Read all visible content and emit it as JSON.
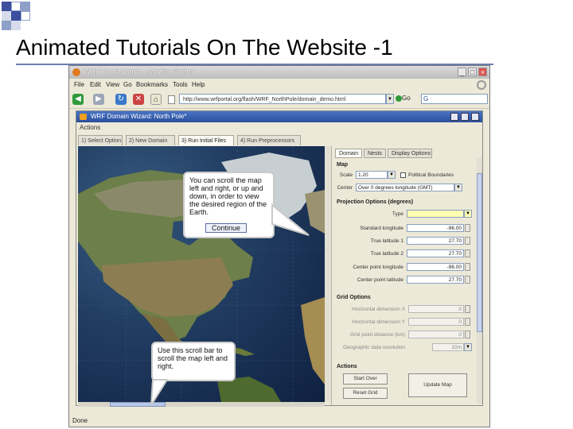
{
  "slide": {
    "title": "Animated Tutorials On The Website -1",
    "accent_color": "#3b4f9e"
  },
  "browser": {
    "window_title": "WRF Portal Demo - Mozilla Firefox",
    "menu": [
      "File",
      "Edit",
      "View",
      "Go",
      "Bookmarks",
      "Tools",
      "Help"
    ],
    "url": "http://www.wrfportal.org/flash/WRF_NorthPole/domain_demo.html",
    "go_label": "Go",
    "status_text": "Done"
  },
  "app": {
    "window_title": "WRF Domain Wizard: North Pole*",
    "menu_label": "Actions",
    "tabs": [
      "1) Select Option",
      "2) New Domain",
      "3) Run Initial Files",
      "4) Run Preprocessors"
    ],
    "panel_tabs": [
      "Domain",
      "Nests",
      "Display Options"
    ],
    "map_section": {
      "title": "Map",
      "scale_label": "Scale",
      "scale_value": "1.20",
      "political_boundaries_label": "Political Boundaries",
      "center_label": "Center",
      "center_value": "Over 0 degrees longitude (GMT)"
    },
    "projection_section": {
      "title": "Projection Options (degrees)",
      "fields": [
        {
          "label": "Type",
          "value": ""
        },
        {
          "label": "Standard longitude",
          "value": "-96.00"
        },
        {
          "label": "True latitude 1",
          "value": "27.70"
        },
        {
          "label": "True latitude 2",
          "value": "27.70"
        },
        {
          "label": "Center point longitude",
          "value": "-96.00"
        },
        {
          "label": "Center point latitude",
          "value": "27.70"
        }
      ]
    },
    "grid_section": {
      "title": "Grid Options",
      "fields": [
        {
          "label": "Horizontal dimension X",
          "value": "0"
        },
        {
          "label": "Horizontal dimension Y",
          "value": "0"
        },
        {
          "label": "Grid point distance (km)",
          "value": "0"
        },
        {
          "label": "Geographic data resolution",
          "value": "10m"
        }
      ]
    },
    "actions_section": {
      "title": "Actions",
      "start_label": "Start Over",
      "reset_label": "Reset Grid",
      "update_label": "Update Map"
    }
  },
  "callouts": {
    "map_scroll": {
      "text": "You can scroll the map left and right, or up and down, in order to view the desired region of the Earth.",
      "button": "Continue"
    },
    "scrollbar": {
      "text": "Use this scroll bar to scroll the map left and right."
    }
  }
}
